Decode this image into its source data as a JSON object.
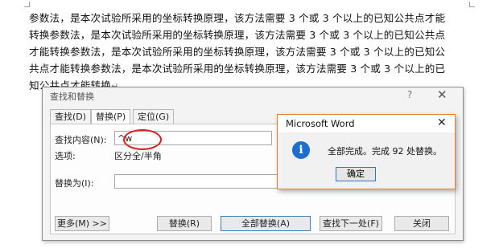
{
  "document": {
    "lines": [
      "参数法，是本次试验所采用的坐标转换原理，该方法需要 3 个或 3 个以上的已知公共点才能",
      "转换参数法，是本次试验所采用的坐标转换原理，该方法需要 3 个或 3 个以上的已知公共点",
      "才能转换参数法，是本次试验所采用的坐标转换原理，该方法需要 3 个或 3 个以上的已知公",
      "共点才能转换参数法，是本次试验所采用的坐标转换原理，该方法需要 3 个或 3 个以上的已",
      "知公共点才能转换"
    ],
    "paragraph_mark": "↵"
  },
  "find_replace": {
    "title": "查找和替换",
    "help": "?",
    "close": "✕",
    "tabs": [
      "查找(D)",
      "替换(P)",
      "定位(G)"
    ],
    "find_label": "查找内容(N):",
    "find_value": "^w",
    "options_label": "选项:",
    "options_value": "区分全/半角",
    "replace_label": "替换为(I):",
    "replace_value": "",
    "buttons": {
      "more": "更多(M) >>",
      "replace": "替换(R)",
      "replace_all": "全部替换(A)",
      "find_next": "查找下一处(F)",
      "close": "关闭"
    }
  },
  "message_box": {
    "title": "Microsoft Word",
    "close": "✕",
    "icon": "i",
    "message": "全部完成。完成 92 处替换。",
    "ok": "确定"
  },
  "colors": {
    "annotation": "#d81f1f",
    "info_icon": "#1d6fcf",
    "message_border": "#d97f2b"
  }
}
